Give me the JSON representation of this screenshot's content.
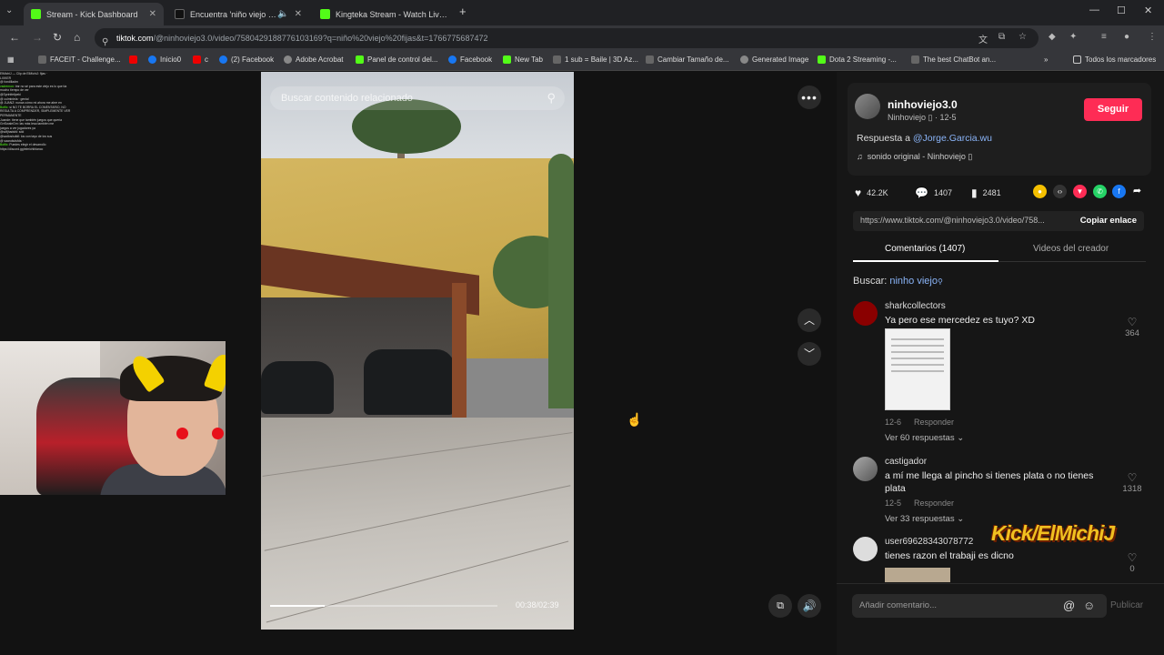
{
  "browser": {
    "tabs": [
      {
        "title": "Stream - Kick Dashboard",
        "active": true
      },
      {
        "title": "Encuentra 'niño viejo fijas'",
        "active": false
      },
      {
        "title": "Kingteka Stream - Watch Live c",
        "active": false
      }
    ],
    "url_host": "tiktok.com",
    "url_rest": "/@ninhoviejo3.0/video/7580429188776103169?q=niño%20viejo%20fijas&t=1766775687472",
    "bookmarks": [
      {
        "label": "FACEIT - Challenge...",
        "icon": "app-icon"
      },
      {
        "label": "",
        "icon": "youtube-icon"
      },
      {
        "label": "Inicio0",
        "icon": "facebook-icon"
      },
      {
        "label": "c",
        "icon": "youtube-icon"
      },
      {
        "label": "(2) Facebook",
        "icon": "facebook-icon"
      },
      {
        "label": "Adobe Acrobat",
        "icon": "globe-icon"
      },
      {
        "label": "Panel de control del...",
        "icon": "kick-icon"
      },
      {
        "label": "Facebook",
        "icon": "facebook-icon"
      },
      {
        "label": "New Tab",
        "icon": "kick-icon"
      },
      {
        "label": "1 sub = Baile | 3D Az...",
        "icon": "app-icon"
      },
      {
        "label": "Cambiar Tamaño de...",
        "icon": "app-icon"
      },
      {
        "label": "Generated Image",
        "icon": "globe-icon"
      },
      {
        "label": "Dota 2 Streaming -...",
        "icon": "kick-icon"
      },
      {
        "label": "The best ChatBot an...",
        "icon": "app-icon"
      }
    ],
    "all_bookmarks": "Todos los marcadores"
  },
  "overlay_chat": [
    {
      "name": "",
      "text": "ElMichiJ — Clip de ElMichiJ: fijas ·"
    },
    {
      "name": "",
      "text": "LIXKER"
    },
    {
      "name": "",
      "text": "@ fondilladm"
    },
    {
      "name": "vsdremon",
      "text": "tmr no sé para este viejo es lo que tía"
    },
    {
      "name": "",
      "text": "mucho tiempo de ver"
    },
    {
      "name": "",
      "text": "@Sprintfelipeki"
    },
    {
      "name": "",
      "text": "@ culminiela · genial"
    },
    {
      "name": "",
      "text": "@ JUANZ: nunca cómo mi ahora me abre en"
    },
    {
      "name": "Botfix",
      "text": "si NO TE BORRA EL COMENTARIO, NO"
    },
    {
      "name": "",
      "text": "RESULTA A COMPRENDER, SIMPLEMENTE VER"
    },
    {
      "name": "",
      "text": "PERMANENTE"
    },
    {
      "name": "",
      "text": "Juande: tiene que también juegos que quería"
    },
    {
      "name": "",
      "text": "GrrSwaleGrn: las más lesa también me"
    },
    {
      "name": "",
      "text": "juegos a ver jugadores ya"
    },
    {
      "name": "",
      "text": "@sdfjhadsfd: sdd"
    },
    {
      "name": "",
      "text": "@sadlosisdidl: los con tayo de los sus"
    },
    {
      "name": "",
      "text": "@ saandsdsfds: ·"
    },
    {
      "name": "Botfix",
      "text": "Puedes elegir el desarrollo"
    },
    {
      "name": "",
      "text": "https://discord.gg/elmichiblanco"
    }
  ],
  "video": {
    "search_placeholder": "Buscar contenido relacionado",
    "time": "00:38/02:39",
    "progress": 0.24
  },
  "author": {
    "name": "ninhoviejo3.0",
    "sub": "Ninhoviejo ▯ · 12-5",
    "follow_label": "Seguir",
    "reply_prefix": "Respuesta a ",
    "reply_mention": "@Jorge.Garcia.wu",
    "sound": "sonido original - Ninhoviejo ▯"
  },
  "stats": {
    "likes": "42.2K",
    "comments": "1407",
    "saves": "2481"
  },
  "share": {
    "link": "https://www.tiktok.com/@ninhoviejo3.0/video/758...",
    "copy_label": "Copiar enlace"
  },
  "tabs": {
    "comments": "Comentarios (1407)",
    "creator": "Videos del creador"
  },
  "search": {
    "prefix": "Buscar: ",
    "keyword": "ninho viejo"
  },
  "comments": [
    {
      "user": "sharkcollectors",
      "text": "Ya pero ese mercedez es tuyo? XD",
      "date": "12-6",
      "reply": "Responder",
      "likes": "364",
      "more": "Ver 60 respuestas ⌄"
    },
    {
      "user": "castigador",
      "text": "a mí me llega al pincho si tienes plata o no tienes plata",
      "date": "12-5",
      "reply": "Responder",
      "likes": "1318",
      "more": "Ver 33 respuestas ⌄"
    },
    {
      "user": "user69628343078772",
      "text": "tienes razon el trabaji es dicno",
      "date": "",
      "reply": "",
      "likes": "0",
      "more": ""
    }
  ],
  "watermark": "Kick/ElMichiJ",
  "comment_input": {
    "placeholder": "Añadir comentario...",
    "publish_label": "Publicar"
  },
  "colors": {
    "follow": "#fe2c55",
    "kick": "#53fc18",
    "mention": "#8ab4f8"
  }
}
